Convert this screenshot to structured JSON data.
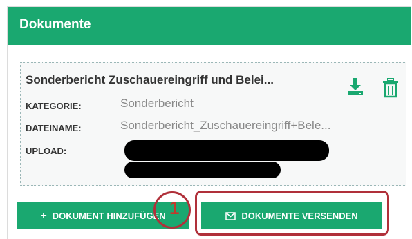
{
  "panel": {
    "title": "Dokumente"
  },
  "document": {
    "title": "Sonderbericht Zuschauereingriff und Belei...",
    "fields": [
      {
        "label": "KATEGORIE:",
        "value": "Sonderbericht"
      },
      {
        "label": "DATEINAME:",
        "value": "Sonderbericht_Zuschauereingriff+Bele..."
      },
      {
        "label": "UPLOAD:",
        "value": ""
      }
    ],
    "download_icon": "download-icon",
    "delete_icon": "trash-icon"
  },
  "actions": {
    "add_icon": "+",
    "add_label": "DOKUMENT HINZUFÜGEN",
    "send_icon": "envelope-icon",
    "send_label": "DOKUMENTE VERSENDEN"
  },
  "annotation": {
    "number": "1"
  },
  "colors": {
    "accent": "#1aa870",
    "annotation": "#b0303a"
  }
}
